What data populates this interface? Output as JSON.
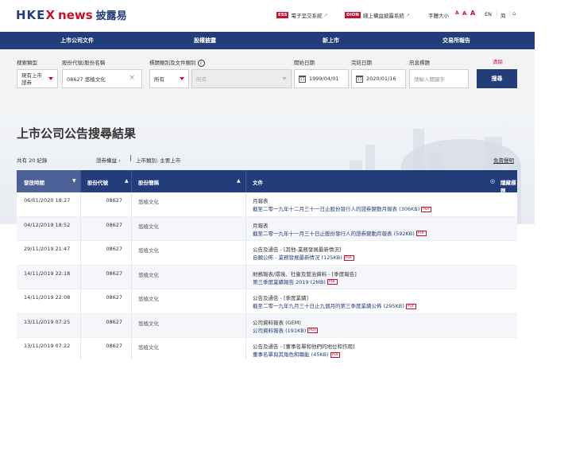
{
  "header": {
    "logo_main": "HKE",
    "logo_x": "X",
    "logo_news": "news",
    "logo_cn": "披露易",
    "ess_badge": "ESS",
    "ess_label": "電子呈交系統",
    "dion_badge": "DION",
    "dion_label": "綫上權益披露系統",
    "font_size_label": "字體大小",
    "font_a": "A",
    "lang_en": "EN",
    "lang_simplified": "简"
  },
  "nav": {
    "items": [
      "上市公司文件",
      "股權披露",
      "新上市",
      "交易所報告"
    ]
  },
  "search": {
    "type_label": "搜索類型",
    "type_value_line1": "現有上市",
    "type_value_line2": "證券",
    "stock_label": "股份代號/股份名稱",
    "stock_value": "08627 悠植文化",
    "category_label": "標題類別及文件類別",
    "category_value": "所有",
    "subcategory_value": "所有",
    "start_label": "開始日期",
    "start_value": "1999/04/01",
    "end_label": "完結日期",
    "end_value": "2020/01/16",
    "keyword_label": "訊息標題",
    "keyword_placeholder": "請輸入關鍵字",
    "clear_label": "清除",
    "search_button": "搜尋"
  },
  "results": {
    "title": "上市公司公告搜尋結果",
    "total": "共有 20 紀錄",
    "crumb_equity": "證券權益",
    "crumb_category": "上市類別: 主要上市",
    "disclaimer": "免責聲明",
    "columns": {
      "date": "發放時間",
      "code": "股份代號",
      "name": "股份簡稱",
      "doc": "文件",
      "hide": "隱藏標題"
    },
    "rows": [
      {
        "date": "06/01/2020 18:27",
        "code": "08627",
        "name": "悠植文化",
        "doc_type": "月報表",
        "doc_title": "截至二零一九年十二月三十一日止股份發行人的證券變動月報表 (306KB)"
      },
      {
        "date": "04/12/2019 18:52",
        "code": "08627",
        "name": "悠植文化",
        "doc_type": "月報表",
        "doc_title": "截至二零一九年十一月三十日止股份發行人的證券變動月報表 (592KB)"
      },
      {
        "date": "29/11/2019 21:47",
        "code": "08627",
        "name": "悠植文化",
        "doc_type": "公告及通告 - [其他-業務發展最新情況]",
        "doc_title": "自願公佈 - 業務發展最新情況 (125KB)"
      },
      {
        "date": "14/11/2019 22:18",
        "code": "08627",
        "name": "悠植文化",
        "doc_type": "財務報表/環境、社會及管治資料 - [季度報告]",
        "doc_title": "第三季度業績報告 2019 (2MB)"
      },
      {
        "date": "14/11/2019 22:08",
        "code": "08627",
        "name": "悠植文化",
        "doc_type": "公告及通告 - [季度業績]",
        "doc_title": "截至二零一九年九月三十日止九個月的第三季度業績公佈 (295KB)"
      },
      {
        "date": "13/11/2019 07:25",
        "code": "08627",
        "name": "悠植文化",
        "doc_type": "公司資料報表 (GEM)",
        "doc_title": "公司資料報表 (191KB)"
      },
      {
        "date": "13/11/2019 07:22",
        "code": "08627",
        "name": "悠植文化",
        "doc_type": "公告及通告 - [董事名單和他們的地位和作用]",
        "doc_title": "董事名單與其角色和職能 (45KB)"
      }
    ],
    "pdf_label": "PDF"
  }
}
